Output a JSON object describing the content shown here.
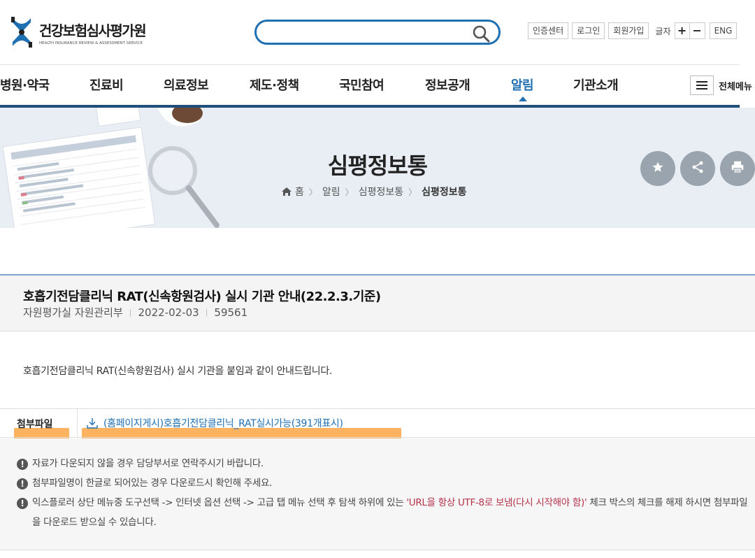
{
  "header": {
    "logo_korean": "건강보험심사평가원",
    "logo_english": "HEALTH INSURANCE REVIEW & ASSESSMENT SERVICE",
    "search": {
      "placeholder": "",
      "value": "",
      "icon": "search-icon"
    },
    "util": {
      "cert": "인증센터",
      "login": "로그인",
      "join": "회원가입",
      "font_label": "글자",
      "font_plus": "+",
      "font_minus": "−",
      "lang": "ENG"
    }
  },
  "gnb": {
    "items": [
      "병원·약국",
      "진료비",
      "의료정보",
      "제도·정책",
      "국민참여",
      "정보공개",
      "알림",
      "기관소개"
    ],
    "active": "알림",
    "all_menu": "전체메뉴"
  },
  "visual": {
    "title": "심평정보통",
    "breadcrumb": [
      "홈",
      "알림",
      "심평정보통",
      "심평정보통"
    ],
    "actions": [
      "star-icon",
      "share-icon",
      "print-icon"
    ]
  },
  "article": {
    "title": "호흡기전담클리닉 RAT(신속항원검사) 실시 기관 안내(22.2.3.기준)",
    "department": "자원평가실 자원관리부",
    "date": "2022-02-03",
    "views": "59561",
    "body": "호흡기전담클리닉 RAT(신속항원검사) 실시 기관을 붙임과 같이 안내드립니다.",
    "attachment_label": "첨부파일",
    "attachment_file": "(홈페이지게시)호흡기전담클리닉_RAT실시가능(391개표시)"
  },
  "notices": {
    "n1": "자료가 다운되지 않을 경우 담당부서로 연락주시기 바랍니다.",
    "n2": "첨부파일명이 한글로 되어있는 경우 다운로드시 확인해 주세요.",
    "n3_before": "익스플로러 상단 메뉴중 도구선택 -> 인터넷 옵션 선택 -> 고급 탭 메뉴 선택 후 탐색 하위에 있는 ",
    "n3_red": "'URL을 항상 UTF-8로 보냄(다시 시작해야 함)'",
    "n3_after": " 체크 박스의 체크를 해제 하시면 첨부파일을 다운로드 받으실 수 있습니다."
  },
  "colors": {
    "brand_blue": "#1f6fb3",
    "gnb_underline": "#1f4e79",
    "highlight": "#fba542",
    "notice_red": "#b5334a"
  }
}
